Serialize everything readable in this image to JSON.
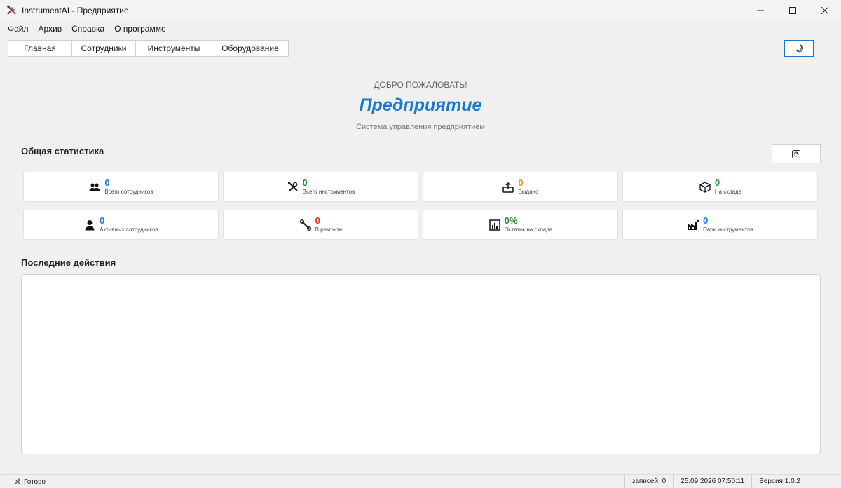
{
  "window": {
    "title": "InstrumentAI - Предприятие",
    "app_icon": "tools-icon"
  },
  "menu": [
    {
      "label": "Файл"
    },
    {
      "label": "Архив"
    },
    {
      "label": "Справка"
    },
    {
      "label": "О программе"
    }
  ],
  "tabs": [
    {
      "label": "Главная"
    },
    {
      "label": "Сотрудники"
    },
    {
      "label": "Инструменты"
    },
    {
      "label": "Оборудование"
    }
  ],
  "toolbar": {
    "theme_icon": "moon-icon"
  },
  "header": {
    "welcome": "ДОБРО ПОЖАЛОВАТЬ!",
    "company": "Предприятие",
    "subtitle": "Система управления предприятием"
  },
  "stats_section": {
    "title": "Общая статистика",
    "refresh_icon": "refresh-icon"
  },
  "stats": [
    {
      "value": "0",
      "label": "Всего сотрудников",
      "icon": "users-icon",
      "color": "#1a7ad1"
    },
    {
      "value": "0",
      "label": "Всего инструментов",
      "icon": "tools-icon",
      "color": "#218a36"
    },
    {
      "value": "0",
      "label": "Выдано",
      "icon": "outbox-icon",
      "color": "#e89a17"
    },
    {
      "value": "0",
      "label": "На складе",
      "icon": "box-icon",
      "color": "#218a36"
    },
    {
      "value": "0",
      "label": "Активных сотрудников",
      "icon": "user-icon",
      "color": "#1a7ad1"
    },
    {
      "value": "0",
      "label": "В ремонте",
      "icon": "wrench-icon",
      "color": "#d52b2b"
    },
    {
      "value": "0%",
      "label": "Остаток на складе",
      "icon": "bar-chart-icon",
      "color": "#218a36"
    },
    {
      "value": "0",
      "label": "Парк инструментов",
      "icon": "factory-icon",
      "color": "#1a7ad1"
    }
  ],
  "activity": {
    "title": "Последние действия"
  },
  "status": {
    "ready": "Готово",
    "records": "записей: 0",
    "datetime": "25.09.2026 07:50:11",
    "version": "Версия 1.0.2"
  }
}
